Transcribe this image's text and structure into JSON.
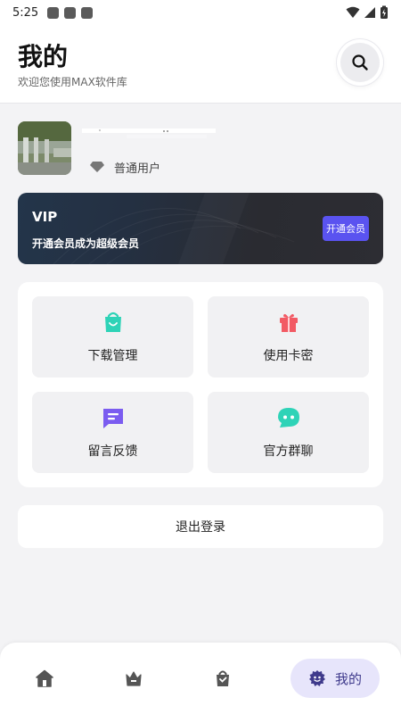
{
  "status_bar": {
    "time": "5:25"
  },
  "header": {
    "title": "我的",
    "subtitle": "欢迎您使用MAX软件库",
    "search_icon": "search-icon"
  },
  "user": {
    "member_level": "普通用户",
    "member_icon": "diamond-icon"
  },
  "vip": {
    "title": "VIP",
    "description": "开通会员成为超级会员",
    "button_label": "开通会员"
  },
  "menu": {
    "items": [
      {
        "label": "下载管理",
        "icon": "shopping-bag-icon",
        "color": "#2ed3b7"
      },
      {
        "label": "使用卡密",
        "icon": "gift-icon",
        "color": "#f25a64"
      },
      {
        "label": "留言反馈",
        "icon": "message-icon",
        "color": "#7b5cf0"
      },
      {
        "label": "官方群聊",
        "icon": "chat-icon",
        "color": "#2ed3b7"
      }
    ]
  },
  "logout": {
    "label": "退出登录"
  },
  "bottom_nav": {
    "items": [
      {
        "icon": "home-icon"
      },
      {
        "icon": "crown-icon"
      },
      {
        "icon": "bag-icon"
      },
      {
        "icon": "profile-icon",
        "label": "我的",
        "active": true
      }
    ]
  },
  "colors": {
    "accent": "#5a53f0",
    "nav_active_bg": "#e7e5fb",
    "page_bg": "#f3f3f5"
  }
}
